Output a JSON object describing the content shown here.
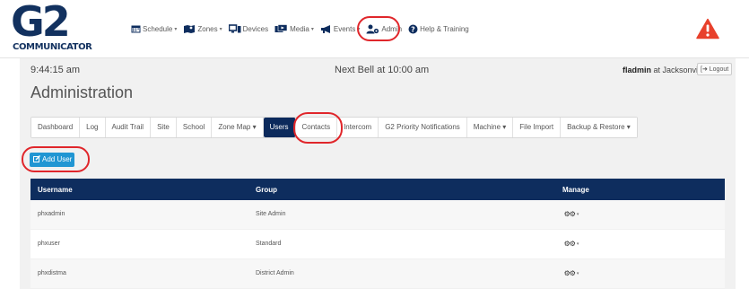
{
  "brand": {
    "logo": "G2",
    "subtitle": "COMMUNICATOR"
  },
  "nav": [
    {
      "label": "Schedule",
      "icon": "calendar-icon",
      "dropdown": true
    },
    {
      "label": "Zones",
      "icon": "map-icon",
      "dropdown": true
    },
    {
      "label": "Devices",
      "icon": "devices-icon",
      "dropdown": false
    },
    {
      "label": "Media",
      "icon": "media-icon",
      "dropdown": true
    },
    {
      "label": "Events",
      "icon": "megaphone-icon",
      "dropdown": true
    },
    {
      "label": "Admin",
      "icon": "users-gear-icon",
      "dropdown": false
    },
    {
      "label": "Help & Training",
      "icon": "help-icon",
      "dropdown": false
    }
  ],
  "status": {
    "time": "9:44:15 am",
    "next_bell": "Next Bell at 10:00 am",
    "user_name": "fladmin",
    "user_site": " at Jacksonville",
    "logout_label": "Logout"
  },
  "page_title": "Administration",
  "tabs": [
    {
      "label": "Dashboard"
    },
    {
      "label": "Log"
    },
    {
      "label": "Audit Trail"
    },
    {
      "label": "Site"
    },
    {
      "label": "School"
    },
    {
      "label": "Zone Map ▾"
    },
    {
      "label": "Users",
      "active": true
    },
    {
      "label": "Contacts"
    },
    {
      "label": "Intercom"
    },
    {
      "label": "G2 Priority Notifications"
    },
    {
      "label": "Machine ▾"
    },
    {
      "label": "File Import"
    },
    {
      "label": "Backup & Restore ▾"
    }
  ],
  "add_user_label": "Add User",
  "table": {
    "columns": [
      "Username",
      "Group",
      "Manage"
    ],
    "rows": [
      {
        "username": "phxadmin",
        "group": "Site Admin"
      },
      {
        "username": "phxuser",
        "group": "Standard"
      },
      {
        "username": "phxdistma",
        "group": "District Admin"
      }
    ]
  },
  "colors": {
    "nav_dark": "#0e2d5e",
    "accent_blue": "#2196d3",
    "alert_red": "#e8412c",
    "highlight_red": "#e0262b"
  }
}
